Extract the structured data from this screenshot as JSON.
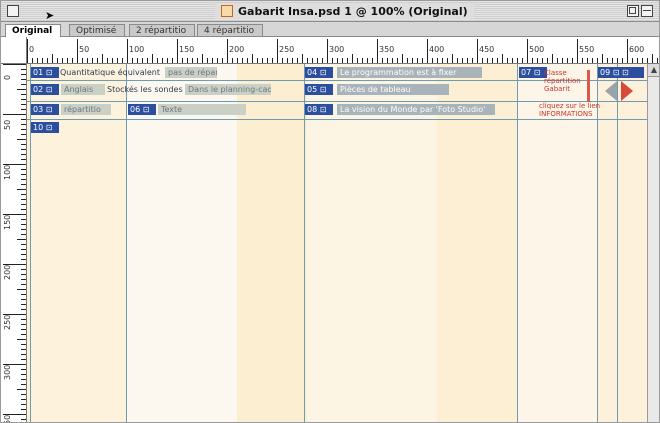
{
  "window": {
    "title": "Gabarit Insa.psd 1 @ 100% (Original)"
  },
  "tabs": [
    {
      "label": "Original",
      "active": true
    },
    {
      "label": "Optimisé",
      "active": false
    },
    {
      "label": "2 répartitio",
      "active": false
    },
    {
      "label": "4 répartitio",
      "active": false
    }
  ],
  "ruler": {
    "h_labels": [
      "0",
      "50",
      "100",
      "150",
      "200",
      "250",
      "300",
      "350",
      "400",
      "450",
      "500",
      "550",
      "600"
    ],
    "v_labels": [
      "0",
      "50",
      "100",
      "150",
      "200",
      "250",
      "300",
      "350"
    ]
  },
  "slices": {
    "row1": {
      "tag1": "01 ⊡",
      "text1": "Quantitatique équivalent",
      "bar1": "pas de répartition",
      "tag2": "04 ⊡",
      "bar2": "Le programmation est à fixer",
      "tag3": "07 ⊡",
      "tag4": "09 ⊡ ⊡"
    },
    "row2": {
      "tag1": "02 ⊡",
      "bar1": "Anglais",
      "text1": "Stockés les sondes",
      "bar2": "Dans le planning-cadre",
      "tag2": "05 ⊡",
      "bar3": "Pièces de tableau",
      "red": [
        "Classe",
        "répartition",
        "Gabarit"
      ]
    },
    "row3": {
      "tag1": "03 ⊡",
      "bar1": "répartitio",
      "tag2": "06 ⊡",
      "bar2": "Texte",
      "tag3": "08 ⊡",
      "bar3": "La vision du Monde par 'Foto Studio'",
      "red": [
        "cliquez sur le lien",
        "INFORMATIONS"
      ]
    },
    "row4": {
      "tag1": "10 ⊡"
    }
  },
  "scrollbar": {
    "up": "▲"
  },
  "colors": {
    "slice_tag": "#2b4f9e",
    "slice_bar": "#a8b3ba",
    "guide": "#6f9bb1",
    "canvas_bg": "#fdf6e6",
    "highlight_red": "#c8352e"
  }
}
